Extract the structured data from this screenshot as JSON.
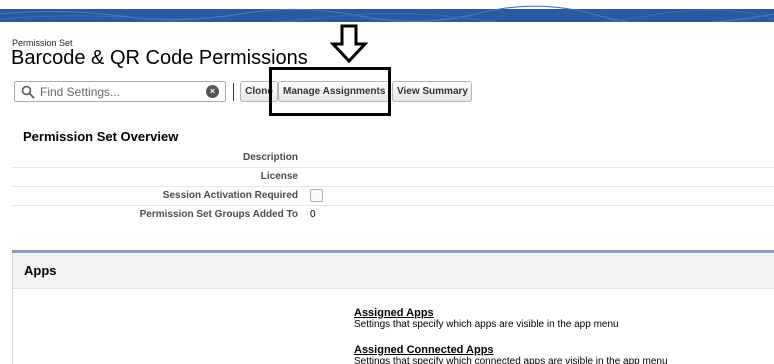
{
  "header": {
    "breadcrumb": "Permission Set",
    "title": "Barcode & QR Code Permissions"
  },
  "toolbar": {
    "search_placeholder": "Find Settings...",
    "clone_label": "Clone",
    "manage_assignments_label": "Manage Assignments",
    "view_summary_label": "View Summary"
  },
  "overview": {
    "title": "Permission Set Overview",
    "rows": [
      {
        "label": "Description",
        "value": ""
      },
      {
        "label": "License",
        "value": ""
      },
      {
        "label": "Session Activation Required",
        "checked": false
      },
      {
        "label": "Permission Set Groups Added To",
        "value": "0"
      }
    ]
  },
  "apps": {
    "title": "Apps",
    "links": [
      {
        "label": "Assigned Apps",
        "description": "Settings that specify which apps are visible in the app menu"
      },
      {
        "label": "Assigned Connected Apps",
        "description": "Settings that specify which connected apps are visible in the app menu"
      }
    ]
  },
  "colors": {
    "banner": "#2c5aa0",
    "highlight": "#000000",
    "apps_border": "#8e9dbf"
  },
  "icons": [
    "search-icon",
    "clear-icon",
    "down-arrow-icon"
  ]
}
